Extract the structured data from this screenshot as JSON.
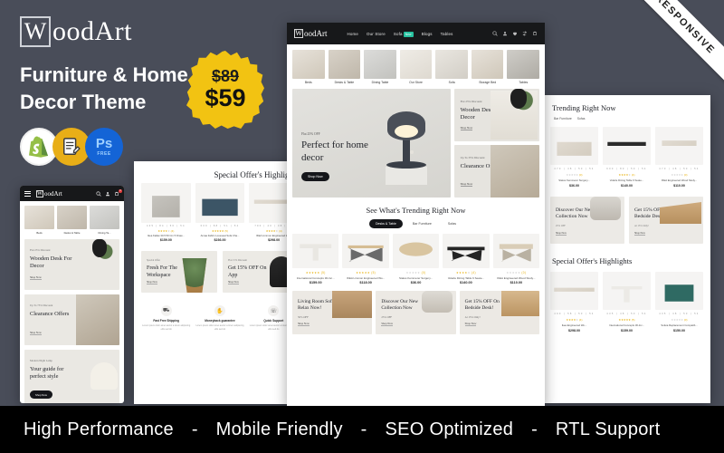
{
  "promo": {
    "brand_mark": "W",
    "brand_rest": "oodArt",
    "title_line1": "Furniture & Home",
    "title_line2": "Decor Theme",
    "badges": [
      {
        "name": "shopify-badge",
        "label": "Shopify"
      },
      {
        "name": "documentation-badge",
        "label": "Docs"
      },
      {
        "name": "photoshop-badge",
        "label": "Ps",
        "sub": "FREE"
      }
    ],
    "price_old": "$89",
    "price_new": "$59",
    "accent_yellow": "#F2C312",
    "background": "#494D59"
  },
  "ribbon": {
    "label": "RESPONSIVE"
  },
  "footer": {
    "items": [
      "High Performance",
      "Mobile Friendly",
      "SEO Optimized",
      "RTL Support"
    ],
    "separator": "-",
    "background": "#000000"
  },
  "desktop": {
    "brand_mark": "W",
    "brand_rest": "oodArt",
    "nav": [
      {
        "label": "Home"
      },
      {
        "label": "Our Store"
      },
      {
        "label": "Sofa",
        "badge": "New"
      },
      {
        "label": "Blogs"
      },
      {
        "label": "Tables"
      }
    ],
    "header_icons": [
      "search-icon",
      "user-icon",
      "wishlist-icon",
      "compare-icon",
      "cart-icon"
    ],
    "categories": [
      "Beds",
      "Desks & Table",
      "Dining Table",
      "Our Store",
      "Sofa",
      "Storage Bed",
      "Tables"
    ],
    "hero": {
      "tag": "Flat 25% OFF",
      "title": "Perfect for home decor",
      "button": "Shop Now"
    },
    "side_cards": [
      {
        "tag": "Flat 25% Discount",
        "title": "Wooden Desk For Decor",
        "link": "Shop Now"
      },
      {
        "tag": "Up To 35% Discount",
        "title": "Clearance Offers",
        "link": "Shop Now"
      }
    ],
    "trending": {
      "heading": "See What's Trending Right Now",
      "tabs": [
        {
          "label": "Desks & Table",
          "active": true
        },
        {
          "label": "Bar Furniture",
          "active": false
        },
        {
          "label": "Sofas",
          "active": false
        }
      ],
      "products": [
        {
          "name": "International Concepts 30-Inc...",
          "price": "$159.00",
          "rating": 5,
          "count": "(5)"
        },
        {
          "name": "IKEA Limmon Engineered Wo...",
          "price": "$118.00",
          "rating": 5,
          "count": "(5)"
        },
        {
          "name": "Status Kemmerer Surgery...",
          "price": "$36.00",
          "rating": 0,
          "count": "(0)"
        },
        {
          "name": "Volarle Dining Table 6 Seate...",
          "price": "$140.00",
          "rating": 4,
          "count": "(4)"
        },
        {
          "name": "IKEA Engineered Wood Study...",
          "price": "$110.00",
          "rating": 0,
          "count": "(0)"
        }
      ]
    },
    "bottom_cards": [
      {
        "title": "Living Room Sofa Relax Now!",
        "tag": "50% OFF",
        "link": "Shop Now"
      },
      {
        "title": "Discover Our New Collection Now",
        "tag": "25% OFF",
        "link": "Shop Now"
      },
      {
        "title": "Get 15% OFF On Bedside Desk!",
        "tag": "At 15% Only!",
        "link": "Shop Now"
      }
    ]
  },
  "tablet_left": {
    "heading": "Special Offer's Highlights",
    "products": [
      {
        "name": "Ikea Kallax 30.5 50 Cm 5 Draw...",
        "price": "$159.00",
        "sizes": "435 | 84 | 50 | 54",
        "rating": 4,
        "count": "(4)"
      },
      {
        "name": "Amaa Fabric Loveseat Sofa Cha...",
        "price": "$236.00",
        "sizes": "600 | 88 | 51 | 54",
        "rating": 5,
        "count": "(5)"
      },
      {
        "name": "IKEA Limmon Engineered Wo...",
        "price": "$298.00",
        "sizes": "790 | 40 | 38 | 54",
        "rating": 4,
        "count": "(4)"
      }
    ],
    "banners": [
      {
        "tag": "Special Offer",
        "title": "Fresh For The Workspace",
        "link": "Shop Now"
      },
      {
        "tag": "Flat 15% Discount",
        "title": "Get 15% OFF On App",
        "link": "Shop Now"
      }
    ],
    "features": [
      {
        "icon": "truck-icon",
        "name": "Fast Free Shipping",
        "desc": "Lorem ipsum dolor amet auctor a lorem adipiscing elits sed do"
      },
      {
        "icon": "thumbs-up-icon",
        "name": "Moneyback guarantee",
        "desc": "Lorem ipsum dolor amet auctor a lorem adipiscing elits sed do"
      },
      {
        "icon": "support-icon",
        "name": "Quick Support",
        "desc": "Lorem ipsum dolor amet auctor a lorem adipiscing elits sed do"
      }
    ]
  },
  "panel_right": {
    "heading_top": "Trending Right Now",
    "tabs": [
      {
        "label": "Bar Furniture"
      },
      {
        "label": "Sofas"
      }
    ],
    "products_top": [
      {
        "name": "Status Kemmerer Surgery...",
        "price": "$36.00",
        "sizes": "470 | 48 | 50 | 54",
        "rating": 0,
        "count": "(0)"
      },
      {
        "name": "Volarle Dining Table 6 Seate...",
        "price": "$140.00",
        "sizes": "600 | 80 | 50 | 54",
        "rating": 4,
        "count": "(4)"
      },
      {
        "name": "IKEA Engineered Wood Study...",
        "price": "$110.00",
        "sizes": "470 | 48 | 50 | 54",
        "rating": 0,
        "count": "(0)"
      }
    ],
    "banners": [
      {
        "title": "Discover Our New Collection Now",
        "tag": "25% OFF",
        "link": "Shop Now"
      },
      {
        "title": "Get 15% OFF On Bedside Desk!",
        "tag": "At 15% Only!",
        "link": "Shop Now"
      }
    ],
    "heading_bottom": "Special Offer's Highlights",
    "products_bottom": [
      {
        "name": "Ikea Engineered Wo...",
        "price": "$298.00",
        "sizes": "490 | 58 | 50 | 54",
        "rating": 4,
        "count": "(4)"
      },
      {
        "name": "International Concepts 30-Inc...",
        "price": "$159.00",
        "sizes": "435 | 48 | 50 | 54",
        "rating": 5,
        "count": "(5)"
      },
      {
        "name": "Sofeia Replacement Compatib...",
        "price": "$150.00",
        "sizes": "435 | 48 | 50 | 54",
        "rating": 0,
        "count": "(0)"
      }
    ]
  },
  "mobile": {
    "brand_mark": "W",
    "brand_rest": "oodArt",
    "menu_icon": "hamburger-icon",
    "header_icons": [
      "search-icon",
      "user-icon",
      "cart-icon"
    ],
    "cart_count": "0",
    "categories": [
      "Beds",
      "Desks & Table",
      "Dining Ta..."
    ],
    "banners": [
      {
        "tag": "Flat 25% Discount",
        "title": "Wooden Desk For Decor",
        "link": "Shop Now"
      },
      {
        "tag": "Up To 75% Discount",
        "title": "Clearance Offers",
        "link": "Shop Now"
      },
      {
        "tag": "Modern Night Lamp",
        "title": "Your guide for perfect style",
        "button": "Shop Now"
      }
    ]
  }
}
